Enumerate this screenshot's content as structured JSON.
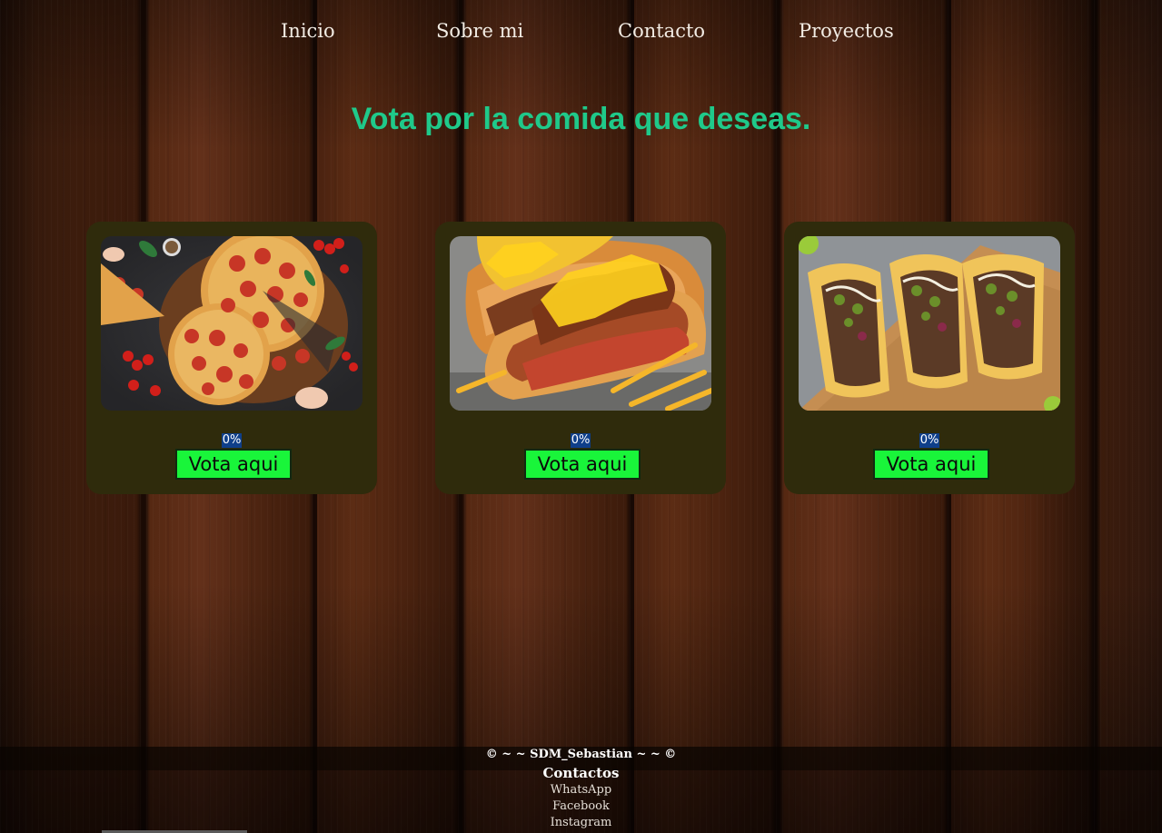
{
  "nav": {
    "items": [
      "Inicio",
      "Sobre mi",
      "Contacto",
      "Proyectos"
    ]
  },
  "headline": "Vota por la comida que deseas.",
  "cards": [
    {
      "food_image": "pizza-photo",
      "percentage": "0%",
      "vote_label": "Vota aqui"
    },
    {
      "food_image": "hotdog-photo",
      "percentage": "0%",
      "vote_label": "Vota aqui"
    },
    {
      "food_image": "tacos-photo",
      "percentage": "0%",
      "vote_label": "Vota aqui"
    }
  ],
  "footer": {
    "copyright": "© ~ ~ SDM_Sebastian ~ ~ ©",
    "contacts_title": "Contactos",
    "links": [
      "WhatsApp",
      "Facebook",
      "Instagram"
    ]
  },
  "colors": {
    "headline": "#1fc98a",
    "card_bg": "#2f2b0c",
    "vote_button": "#19f53a",
    "percentage_bg": "#0f3f8a"
  }
}
